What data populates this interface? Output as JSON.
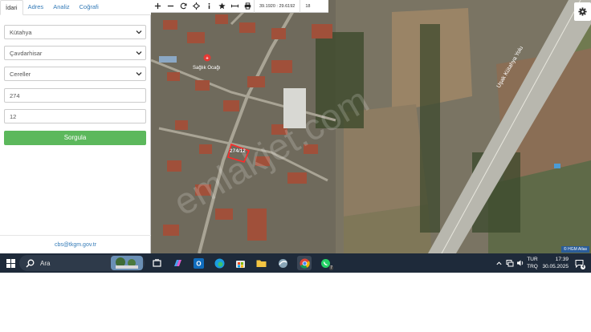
{
  "tabs": [
    "İdari",
    "Adres",
    "Analiz",
    "Coğrafi"
  ],
  "form": {
    "il": "Kütahya",
    "ilce": "Çavdarhisar",
    "mahalle": "Cereller",
    "ada": "274",
    "parsel": "12",
    "submit_label": "Sorgula"
  },
  "footer_email": "cbs@tkgm.gov.tr",
  "map": {
    "coords": "39.1920 : 29.6192",
    "zoom": "18",
    "parcel_label": "274/12",
    "poi_label": "Sağlık Ocağı",
    "road_label": "Uşak Kütahya Yolu",
    "attribution": "© HGM Atlas"
  },
  "taskbar": {
    "search_placeholder": "Ara",
    "lang_line1": "TUR",
    "lang_line2": "TRQ",
    "time": "17:39",
    "date": "30.05.2025",
    "notification_count": "4",
    "whatsapp_badge": "7"
  }
}
